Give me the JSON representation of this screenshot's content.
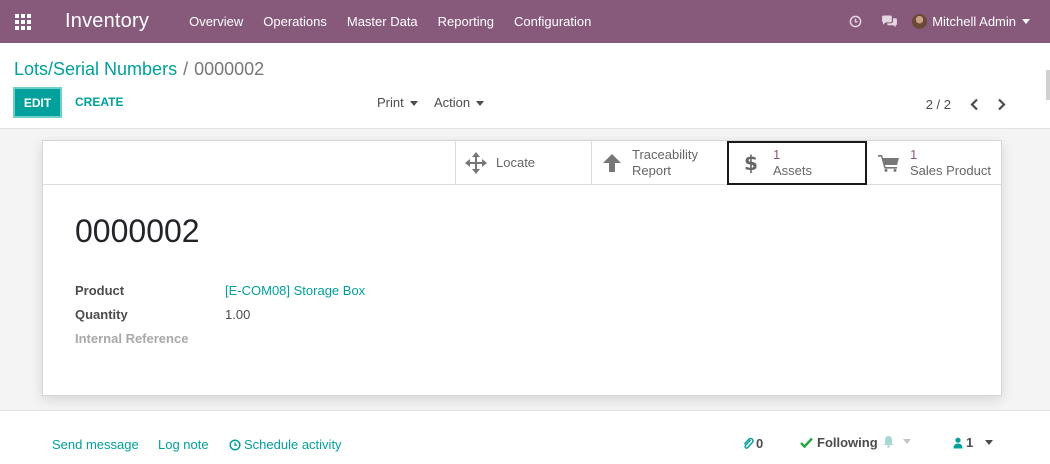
{
  "navbar": {
    "app_title": "Inventory",
    "menu": [
      "Overview",
      "Operations",
      "Master Data",
      "Reporting",
      "Configuration"
    ],
    "user_name": "Mitchell Admin",
    "icons": [
      "apps-grid-icon",
      "clock-icon",
      "chat-icon",
      "avatar"
    ],
    "color": "#875a7b"
  },
  "breadcrumb": {
    "parent": "Lots/Serial Numbers",
    "separator": "/",
    "current": "0000002"
  },
  "toolbar": {
    "edit_label": "EDIT",
    "create_label": "CREATE",
    "print_label": "Print",
    "action_label": "Action",
    "pager_value": "2 / 2"
  },
  "smart_buttons": {
    "locate": {
      "label": "Locate",
      "icon": "arrows-move-icon"
    },
    "traceability": {
      "line1": "Traceability",
      "line2": "Report",
      "icon": "arrow-up-icon"
    },
    "assets": {
      "count": "1",
      "label": "Assets",
      "icon": "dollar-icon"
    },
    "sales": {
      "count": "1",
      "label": "Sales Product",
      "icon": "cart-icon"
    }
  },
  "record": {
    "name": "0000002",
    "fields": [
      {
        "label": "Product",
        "value": "[E-COM08] Storage Box"
      },
      {
        "label": "Quantity",
        "value": "1.00"
      },
      {
        "label": "Internal Reference",
        "value": ""
      }
    ]
  },
  "chatter": {
    "send_message": "Send message",
    "log_note": "Log note",
    "schedule_activity": "Schedule activity",
    "attachments_count": "0",
    "following_label": "Following",
    "followers_count": "1"
  },
  "colors": {
    "accent": "#00a09d",
    "brand": "#875a7b"
  }
}
